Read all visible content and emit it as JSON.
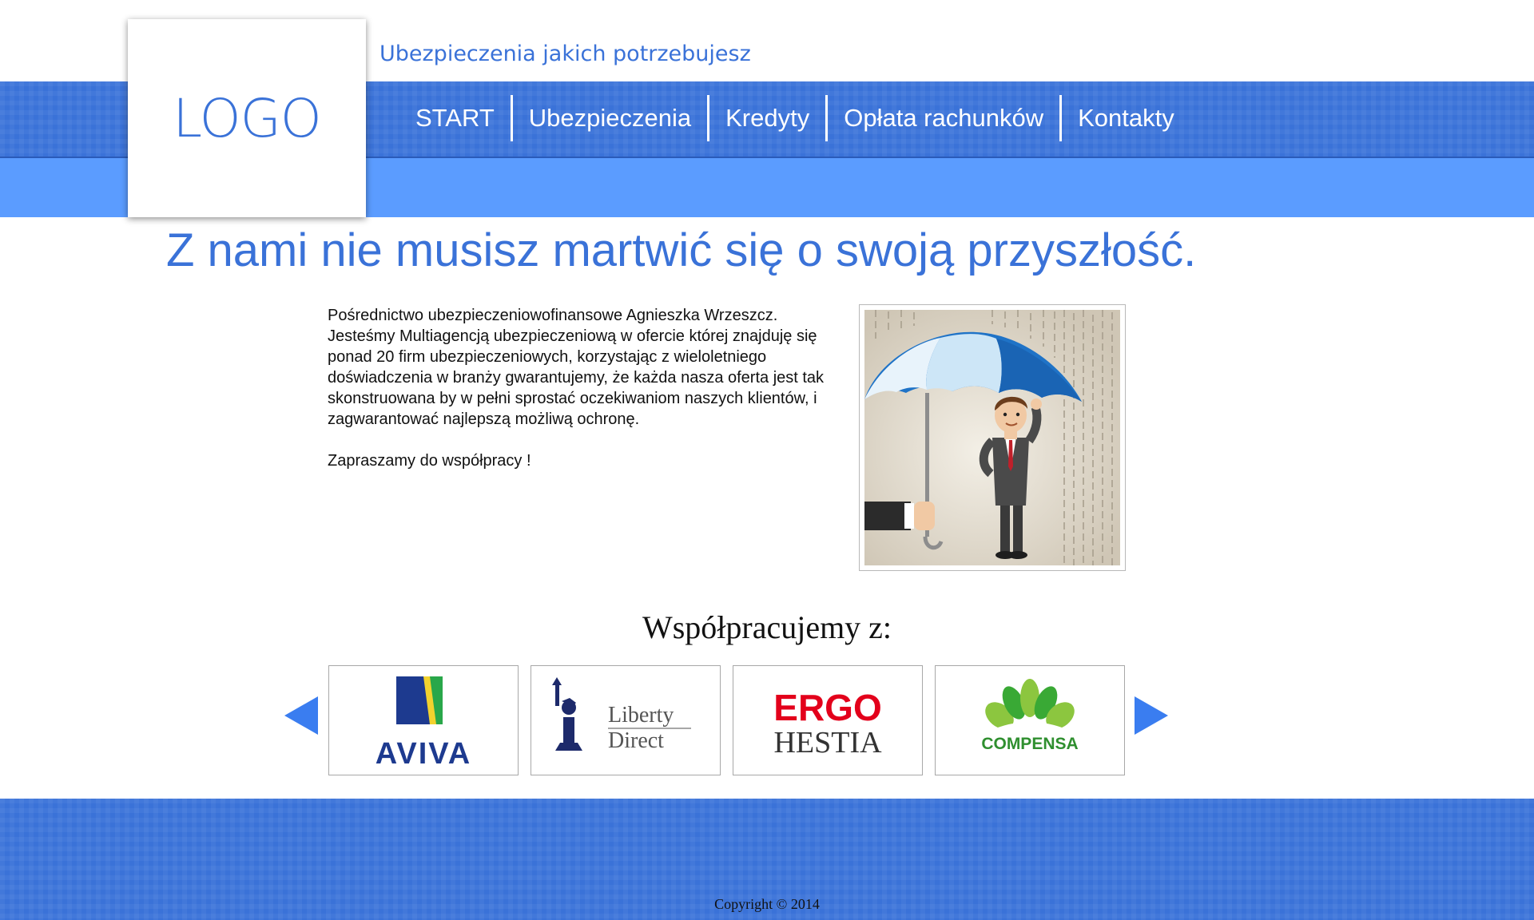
{
  "header": {
    "tagline": "Ubezpieczenia jakich potrzebujesz",
    "logo_text": "LOGO",
    "nav": [
      {
        "label": "START"
      },
      {
        "label": "Ubezpieczenia"
      },
      {
        "label": "Kredyty"
      },
      {
        "label": "Opłata rachunków"
      },
      {
        "label": "Kontakty"
      }
    ]
  },
  "main": {
    "headline": "Z nami nie musisz martwić się o swoją przyszłość.",
    "intro_paragraph": "Pośrednictwo ubezpieczeniowofinansowe Agnieszka Wrzeszcz. Jesteśmy Multiagencją ubezpieczeniową w ofercie której znajduję się ponad 20 firm ubezpieczeniowych, korzystając z wieloletniego doświadczenia w branży gwarantujemy, że każda nasza oferta jest tak skonstruowana by w pełni sprostać oczekiwaniom naszych klientów, i zagwarantować najlepszą możliwą ochronę.",
    "invite": "Zapraszamy do współpracy !"
  },
  "partners": {
    "title": "Współpracujemy z:",
    "logos": [
      {
        "name": "AVIVA",
        "text": "AVIVA",
        "color": "#1d3a8f"
      },
      {
        "name": "Liberty Direct",
        "line1": "Liberty",
        "line2": "Direct",
        "color": "#555555"
      },
      {
        "name": "ERGO HESTIA",
        "line1": "ERGO",
        "line2": "HESTIA",
        "color": "#e3001b"
      },
      {
        "name": "COMPENSA",
        "text": "COMPENSA",
        "color": "#2f8f2f"
      }
    ]
  },
  "footer": {
    "copyright": "Copyright © 2014"
  },
  "colors": {
    "primary": "#3a72d8",
    "secondary": "#5b9cff",
    "arrow": "#3a7df0"
  }
}
